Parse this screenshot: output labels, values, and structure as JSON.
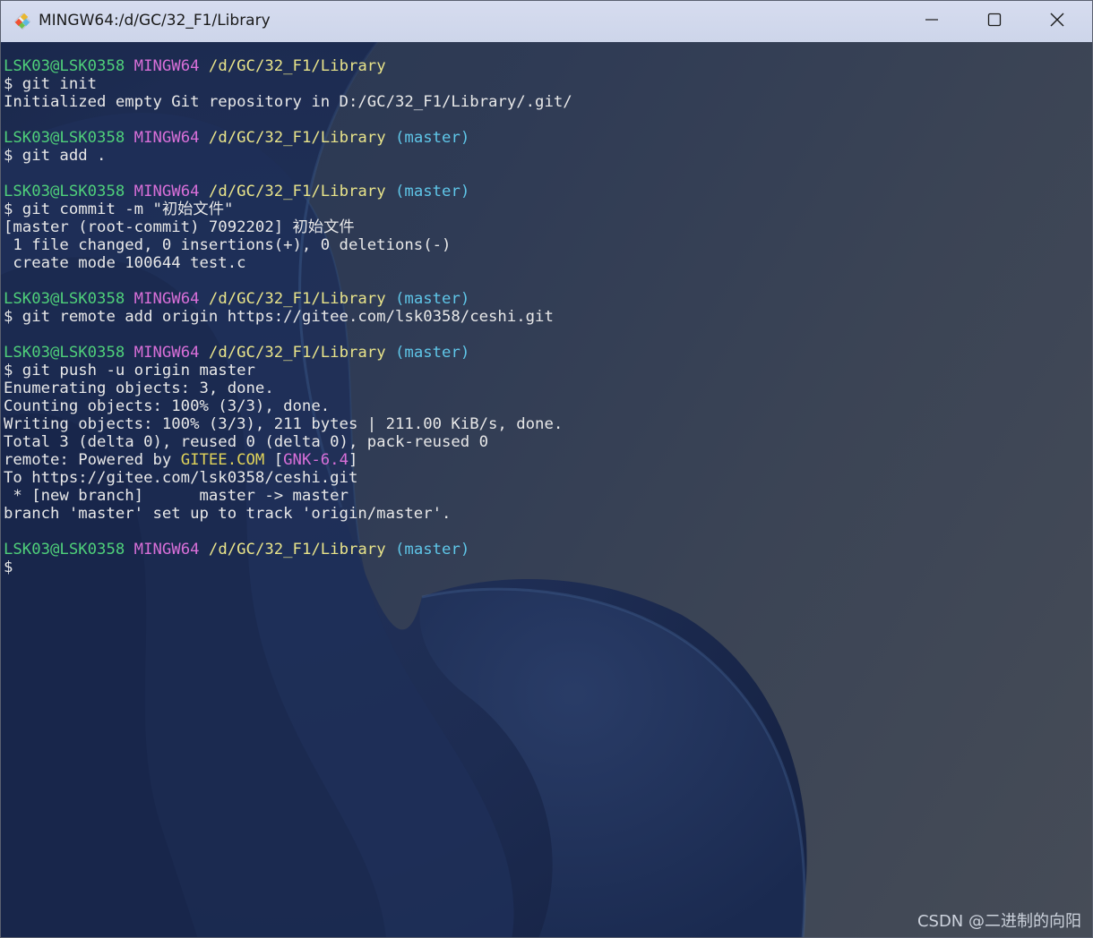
{
  "window": {
    "title": "MINGW64:/d/GC/32_F1/Library",
    "icon": "git-bash-icon",
    "controls": [
      "minimize-icon",
      "maximize-icon",
      "close-icon"
    ]
  },
  "colors": {
    "user_host": "#4fd07a",
    "mingw": "#d86fd8",
    "path": "#e9e48a",
    "branch": "#5fc6e8",
    "output": "#e8e8e8"
  },
  "terminal": {
    "lines": [
      [
        {
          "t": "LSK03@LSK0358",
          "c": "green"
        },
        {
          "t": " ",
          "c": "white"
        },
        {
          "t": "MINGW64",
          "c": "magenta"
        },
        {
          "t": " ",
          "c": "white"
        },
        {
          "t": "/d/GC/32_F1/Library",
          "c": "yellow"
        }
      ],
      [
        {
          "t": "$ git init",
          "c": "white"
        }
      ],
      [
        {
          "t": "Initialized empty Git repository in D:/GC/32_F1/Library/.git/",
          "c": "white"
        }
      ],
      [
        {
          "t": "",
          "c": "white"
        }
      ],
      [
        {
          "t": "LSK03@LSK0358",
          "c": "green"
        },
        {
          "t": " ",
          "c": "white"
        },
        {
          "t": "MINGW64",
          "c": "magenta"
        },
        {
          "t": " ",
          "c": "white"
        },
        {
          "t": "/d/GC/32_F1/Library",
          "c": "yellow"
        },
        {
          "t": " ",
          "c": "white"
        },
        {
          "t": "(master)",
          "c": "cyan"
        }
      ],
      [
        {
          "t": "$ git add .",
          "c": "white"
        }
      ],
      [
        {
          "t": "",
          "c": "white"
        }
      ],
      [
        {
          "t": "LSK03@LSK0358",
          "c": "green"
        },
        {
          "t": " ",
          "c": "white"
        },
        {
          "t": "MINGW64",
          "c": "magenta"
        },
        {
          "t": " ",
          "c": "white"
        },
        {
          "t": "/d/GC/32_F1/Library",
          "c": "yellow"
        },
        {
          "t": " ",
          "c": "white"
        },
        {
          "t": "(master)",
          "c": "cyan"
        }
      ],
      [
        {
          "t": "$ git commit -m \"初始文件\"",
          "c": "white"
        }
      ],
      [
        {
          "t": "[master (root-commit) 7092202] 初始文件",
          "c": "white"
        }
      ],
      [
        {
          "t": " 1 file changed, 0 insertions(+), 0 deletions(-)",
          "c": "white"
        }
      ],
      [
        {
          "t": " create mode 100644 test.c",
          "c": "white"
        }
      ],
      [
        {
          "t": "",
          "c": "white"
        }
      ],
      [
        {
          "t": "LSK03@LSK0358",
          "c": "green"
        },
        {
          "t": " ",
          "c": "white"
        },
        {
          "t": "MINGW64",
          "c": "magenta"
        },
        {
          "t": " ",
          "c": "white"
        },
        {
          "t": "/d/GC/32_F1/Library",
          "c": "yellow"
        },
        {
          "t": " ",
          "c": "white"
        },
        {
          "t": "(master)",
          "c": "cyan"
        }
      ],
      [
        {
          "t": "$ git remote add origin https://gitee.com/lsk0358/ceshi.git",
          "c": "white"
        }
      ],
      [
        {
          "t": "",
          "c": "white"
        }
      ],
      [
        {
          "t": "LSK03@LSK0358",
          "c": "green"
        },
        {
          "t": " ",
          "c": "white"
        },
        {
          "t": "MINGW64",
          "c": "magenta"
        },
        {
          "t": " ",
          "c": "white"
        },
        {
          "t": "/d/GC/32_F1/Library",
          "c": "yellow"
        },
        {
          "t": " ",
          "c": "white"
        },
        {
          "t": "(master)",
          "c": "cyan"
        }
      ],
      [
        {
          "t": "$ git push -u origin master",
          "c": "white"
        }
      ],
      [
        {
          "t": "Enumerating objects: 3, done.",
          "c": "white"
        }
      ],
      [
        {
          "t": "Counting objects: 100% (3/3), done.",
          "c": "white"
        }
      ],
      [
        {
          "t": "Writing objects: 100% (3/3), 211 bytes | 211.00 KiB/s, done.",
          "c": "white"
        }
      ],
      [
        {
          "t": "Total 3 (delta 0), reused 0 (delta 0), pack-reused 0",
          "c": "white"
        }
      ],
      [
        {
          "t": "remote: Powered by ",
          "c": "white"
        },
        {
          "t": "GITEE.COM",
          "c": "ryellow"
        },
        {
          "t": " [",
          "c": "white"
        },
        {
          "t": "GNK-6.4",
          "c": "rmagenta"
        },
        {
          "t": "]",
          "c": "white"
        }
      ],
      [
        {
          "t": "To https://gitee.com/lsk0358/ceshi.git",
          "c": "white"
        }
      ],
      [
        {
          "t": " * [new branch]      master -> master",
          "c": "white"
        }
      ],
      [
        {
          "t": "branch 'master' set up to track 'origin/master'.",
          "c": "white"
        }
      ],
      [
        {
          "t": "",
          "c": "white"
        }
      ],
      [
        {
          "t": "LSK03@LSK0358",
          "c": "green"
        },
        {
          "t": " ",
          "c": "white"
        },
        {
          "t": "MINGW64",
          "c": "magenta"
        },
        {
          "t": " ",
          "c": "white"
        },
        {
          "t": "/d/GC/32_F1/Library",
          "c": "yellow"
        },
        {
          "t": " ",
          "c": "white"
        },
        {
          "t": "(master)",
          "c": "cyan"
        }
      ],
      [
        {
          "t": "$",
          "c": "white"
        }
      ]
    ]
  },
  "watermark": "CSDN @二进制的向阳"
}
